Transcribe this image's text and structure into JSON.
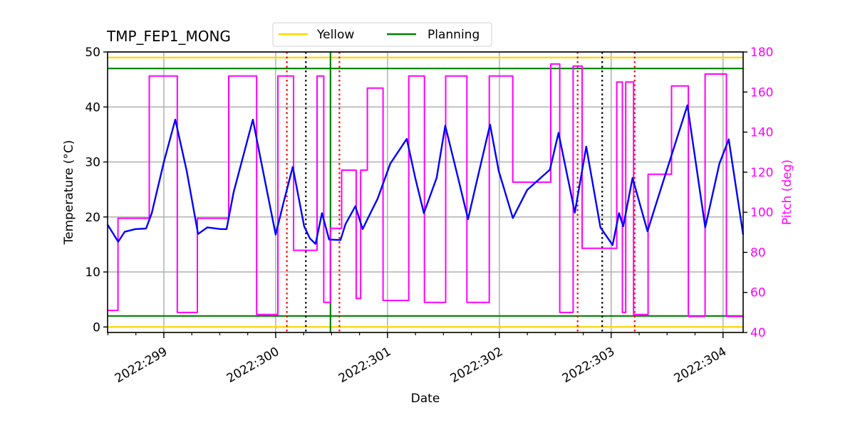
{
  "chart_data": {
    "type": "line",
    "title": "TMP_FEP1_MONG",
    "xlabel": "Date",
    "ylabel": "Temperature ($^\\circ$C)",
    "ylabel_display": "Temperature (°C)",
    "y2label": "Pitch (deg)",
    "xlim": [
      298.497,
      304.18
    ],
    "ylim": [
      -1.0,
      50
    ],
    "y2lim": [
      40,
      180
    ],
    "x_ticks": [
      299,
      300,
      301,
      302,
      303,
      304
    ],
    "x_tick_labels": [
      "2022:299",
      "2022:300",
      "2022:301",
      "2022:302",
      "2022:303",
      "2022:304"
    ],
    "x_minor_tick_step": 0.25,
    "y_ticks": [
      0,
      10,
      20,
      30,
      40,
      50
    ],
    "y_tick_labels": [
      "0",
      "10",
      "20",
      "30",
      "40",
      "50"
    ],
    "y2_ticks": [
      40,
      60,
      80,
      100,
      120,
      140,
      160,
      180
    ],
    "y2_tick_labels": [
      "40",
      "60",
      "80",
      "100",
      "120",
      "140",
      "160",
      "180"
    ],
    "grid": true,
    "legend": {
      "placement": "top-center",
      "entries": [
        {
          "label": "Yellow",
          "color": "#ffd700"
        },
        {
          "label": "Planning",
          "color": "#008000"
        }
      ]
    },
    "colors": {
      "temperature": "#0000ff",
      "pitch": "#ff00ff",
      "yellow": "#ffd700",
      "planning": "#008000",
      "red_marker": "#ff0000",
      "black_marker": "#000000",
      "grid": "#b0b0b0",
      "y2_axis": "#ff00ff"
    },
    "horizontal_limits": [
      {
        "name": "yellow-high",
        "value": 49,
        "color": "#ffd700"
      },
      {
        "name": "yellow-low",
        "value": 0,
        "color": "#ffd700"
      },
      {
        "name": "planning-high",
        "value": 47,
        "color": "#008000"
      },
      {
        "name": "planning-low",
        "value": 2,
        "color": "#008000"
      }
    ],
    "vertical_markers": [
      {
        "x": 300.1,
        "style": "dotted",
        "color": "#ff0000"
      },
      {
        "x": 300.27,
        "style": "dotted",
        "color": "#000000"
      },
      {
        "x": 300.49,
        "style": "solid",
        "color": "#008000"
      },
      {
        "x": 300.57,
        "style": "dotted",
        "color": "#ff0000"
      },
      {
        "x": 302.7,
        "style": "dotted",
        "color": "#ff0000"
      },
      {
        "x": 302.92,
        "style": "dotted",
        "color": "#000000"
      },
      {
        "x": 303.21,
        "style": "dotted",
        "color": "#ff0000"
      }
    ],
    "series": [
      {
        "name": "Temperature",
        "axis": "left",
        "color": "#0000ff",
        "x": [
          298.497,
          298.592,
          298.65,
          298.745,
          298.841,
          298.892,
          299.0,
          299.102,
          299.204,
          299.306,
          299.389,
          299.51,
          299.561,
          299.624,
          299.796,
          299.892,
          300.0,
          300.07,
          300.153,
          300.255,
          300.306,
          300.357,
          300.414,
          300.478,
          300.58,
          300.624,
          300.713,
          300.777,
          300.847,
          300.911,
          301.025,
          301.172,
          301.248,
          301.325,
          301.439,
          301.516,
          301.631,
          301.72,
          301.79,
          301.917,
          301.994,
          302.121,
          302.248,
          302.452,
          302.529,
          302.675,
          302.777,
          302.904,
          303.013,
          303.07,
          303.108,
          303.191,
          303.325,
          303.395,
          303.51,
          303.682,
          303.841,
          303.968,
          304.051,
          304.18
        ],
        "values": [
          18.6,
          15.5,
          17.3,
          17.8,
          17.9,
          20.7,
          30.0,
          37.7,
          28.4,
          16.9,
          18.1,
          17.8,
          17.8,
          24.5,
          37.7,
          27.8,
          16.8,
          22.6,
          29.1,
          18.3,
          16.1,
          15.1,
          20.7,
          15.9,
          15.8,
          18.7,
          21.96,
          17.8,
          20.7,
          23.3,
          29.7,
          34.2,
          27.1,
          20.7,
          27.1,
          36.6,
          27.1,
          19.6,
          25.8,
          36.8,
          28.4,
          19.8,
          24.9,
          28.6,
          35.3,
          20.8,
          32.8,
          18.1,
          14.9,
          20.7,
          18.3,
          27.1,
          17.4,
          21.96,
          29.3,
          40.3,
          18.1,
          29.7,
          34.1,
          16.8
        ]
      },
      {
        "name": "Pitch",
        "axis": "right",
        "color": "#ff00ff",
        "step": true,
        "x": [
          298.497,
          298.59,
          298.87,
          299.12,
          299.3,
          299.58,
          299.83,
          300.0,
          300.02,
          300.16,
          300.37,
          300.43,
          300.45,
          300.49,
          300.59,
          300.72,
          300.76,
          300.82,
          300.96,
          301.19,
          301.33,
          301.52,
          301.71,
          301.91,
          302.12,
          302.46,
          302.54,
          302.66,
          302.74,
          303.05,
          303.1,
          303.13,
          303.2,
          303.33,
          303.54,
          303.69,
          303.84,
          304.03,
          304.18
        ],
        "values": [
          51,
          97,
          168,
          50,
          97,
          168,
          49,
          49,
          168,
          81,
          168,
          55,
          55,
          92,
          121,
          57,
          121,
          162,
          56,
          168,
          55,
          168,
          55,
          168,
          115,
          174,
          50,
          173,
          82,
          165,
          50,
          165,
          49,
          119,
          163,
          48,
          169,
          48,
          48
        ]
      }
    ]
  }
}
